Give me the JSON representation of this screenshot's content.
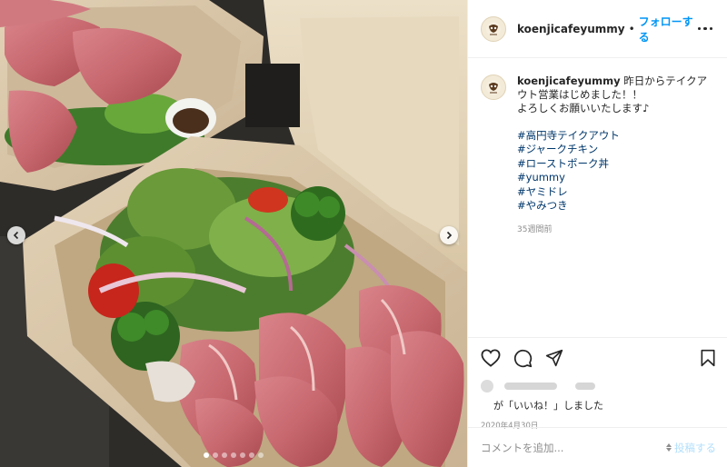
{
  "post": {
    "username": "koenjicafeyummy",
    "separator": "•",
    "follow_label": "フォローする",
    "more_icon": "more-options-icon",
    "caption_lines": [
      "昨日からテイクア",
      "ウト営業はじめました！！",
      "よろしくお願いいたします♪"
    ],
    "hashtags": [
      "#高円寺テイクアウト",
      "#ジャークチキン",
      "#ローストポーク丼",
      "#yummy",
      "#ヤミドレ",
      "#やみつき"
    ],
    "time_ago": "35週間前"
  },
  "photo": {
    "description_icon": "takeout-roast-pork-salad-photo",
    "carousel_total": 7,
    "carousel_active": 1
  },
  "actions": {
    "icons": [
      "heart-icon",
      "comment-icon",
      "share-icon",
      "bookmark-icon"
    ]
  },
  "likes": {
    "suffix": "が「いいね！」しました"
  },
  "date": "2020年4月30日",
  "comment": {
    "placeholder": "コメントを追加...",
    "post_label": "投稿する"
  },
  "colors": {
    "link": "#0095f6",
    "hashtag": "#00376b",
    "muted": "#8e8e8e",
    "post_disabled": "#b2dffc"
  }
}
